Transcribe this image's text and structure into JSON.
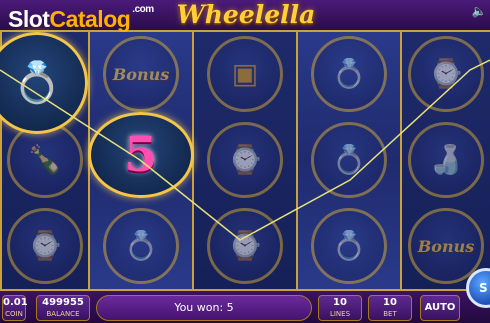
{
  "header": {
    "brand_slot": "Slot",
    "brand_catalog": "Catalog",
    "brand_suffix": ".com",
    "game_title": "Wheelella",
    "sound_icon": "speaker-icon"
  },
  "symbols": {
    "bonus_label": "Bonus",
    "win_value": "5"
  },
  "bottom": {
    "coin_value": "0.01",
    "coin_label": "COIN",
    "balance_value": "499955",
    "balance_label": "BALANCE",
    "win_message": "You won: 5",
    "lines_value": "10",
    "lines_label": "LINES",
    "bet_value": "10",
    "bet_label": "BET",
    "auto_label": "AUTO",
    "spin_label": "S"
  },
  "colors": {
    "frame_gold": "#c9a23a",
    "payline": "#e8e07a",
    "win_pink": "#ff4fb0"
  }
}
